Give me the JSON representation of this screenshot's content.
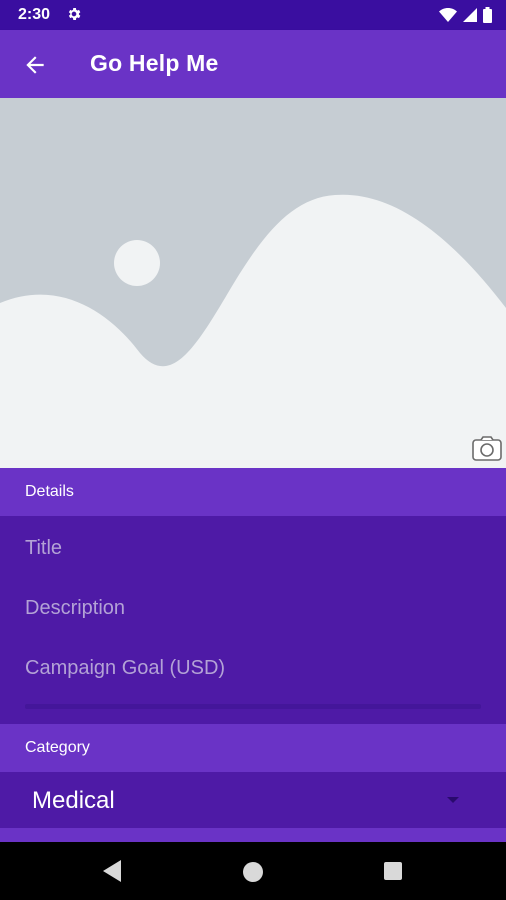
{
  "status_bar": {
    "time": "2:30",
    "icons": [
      "settings-icon",
      "wifi-icon",
      "signal-icon",
      "battery-icon"
    ]
  },
  "app_bar": {
    "title": "Go Help Me",
    "back_icon": "arrow-left-icon"
  },
  "image_placeholder": {
    "icon": "image-placeholder",
    "camera_icon": "camera-icon"
  },
  "details": {
    "header": "Details",
    "fields": {
      "title_placeholder": "Title",
      "description_placeholder": "Description",
      "goal_placeholder": "Campaign Goal (USD)"
    }
  },
  "category": {
    "header": "Category",
    "selected": "Medical"
  },
  "colors": {
    "primary": "#6a33c6",
    "primary_dark": "#3a0ea0",
    "panel": "#4e1aa6",
    "placeholder_bg": "#c6cdd3"
  }
}
